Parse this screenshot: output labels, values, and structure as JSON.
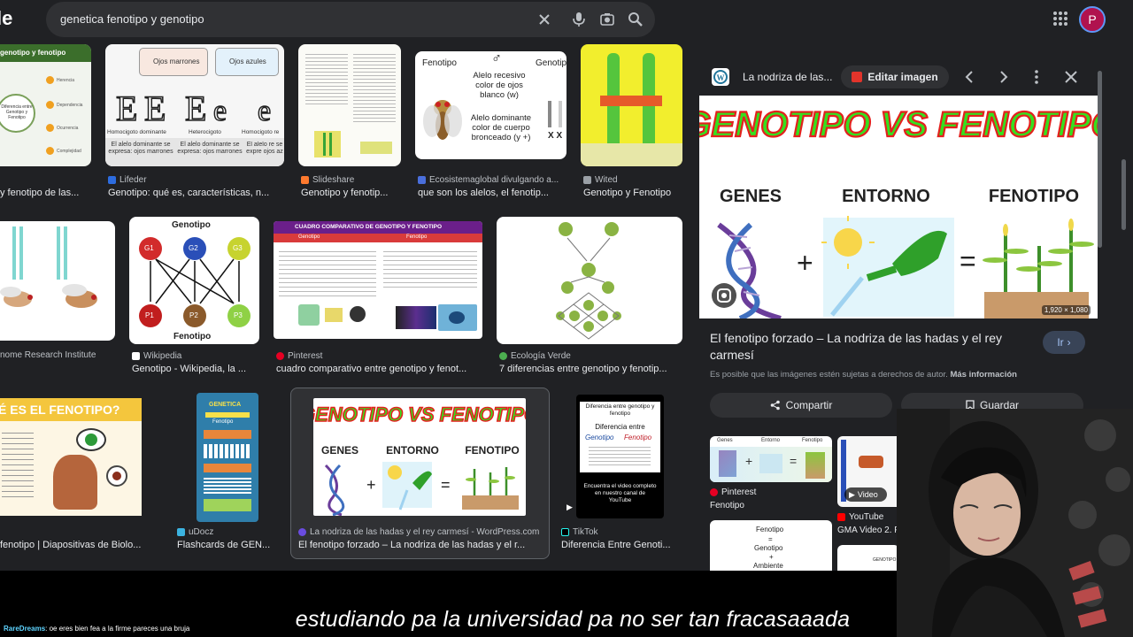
{
  "search": {
    "query": "genetica fenotipo y genotipo",
    "logo_fragment": "le"
  },
  "account": {
    "initial": "P"
  },
  "results": [
    {
      "source": "",
      "title": "y fenotipo de las...",
      "thumb_text": [
        "genotipo y fenotipo",
        "Diferencia entre Genotipo y Fenotipo",
        "Herencia",
        "Dependencia",
        "Ocurrencia",
        "Complejidad"
      ]
    },
    {
      "source": "Lifeder",
      "title": "Genotipo: qué es, características, n...",
      "thumb_text": [
        "Ojos marrones",
        "Ojos azules",
        "Homocigoto dominante",
        "Heterocigoto",
        "Homocigoto re",
        "El alelo dominante se expresa: ojos marrones",
        "El alelo dominante se expresa: ojos marrones",
        "El alelo re se expre ojos az"
      ]
    },
    {
      "source": "Slideshare",
      "title": "Genotipo y fenotip..."
    },
    {
      "source": "Ecosistemaglobal divulgando a...",
      "title": "que son los alelos, el fenotip...",
      "thumb_text": [
        "Fenotipo",
        "Genotip",
        "Alelo recesivo color de ojos blanco (w)",
        "Alelo dominante color de cuerpo bronceado (y +)",
        "X X"
      ]
    },
    {
      "source": "Wited",
      "title": "Genotipo y Fenotipo"
    },
    {
      "source": "",
      "title": "nome Research Institute"
    },
    {
      "source": "Wikipedia",
      "title": "Genotipo - Wikipedia, la ...",
      "thumb_text": [
        "Genotipo",
        "G1",
        "G2",
        "G3",
        "P1",
        "P2",
        "P3",
        "Fenotipo"
      ]
    },
    {
      "source": "Pinterest",
      "title": "cuadro comparativo entre genotipo y fenot...",
      "thumb_text": [
        "CUADRO COMPARATIVO DE GENOTIPO Y FENOTIPO",
        "Genotipo",
        "Fenotipo"
      ]
    },
    {
      "source": "Ecología Verde",
      "title": "7 diferencias entre genotipo y fenotip..."
    },
    {
      "source": "",
      "title": "fenotipo | Diapositivas de Biolo...",
      "thumb_text": [
        "É ES EL FENOTIPO?"
      ]
    },
    {
      "source": "uDocz",
      "title": "Flashcards de GEN...",
      "thumb_text": [
        "GENETICA",
        "Fenotipo"
      ]
    },
    {
      "source": "La nodriza de las hadas y el rey carmesí - WordPress.com",
      "title": "El fenotipo forzado – La nodriza de las hadas y el r...",
      "thumb_text": [
        "GENOTIPO VS FENOTIPO",
        "GENES",
        "ENTORNO",
        "FENOTIPO"
      ]
    },
    {
      "source": "TikTok",
      "title": "Diferencia Entre Genoti...",
      "thumb_text": [
        "Diferencia entre genotipo y fenotipo",
        "Diferencia entre",
        "Genotipo",
        "Fenotipo",
        "Encuentra el video completo en nuestro canal de YouTube"
      ]
    }
  ],
  "panel": {
    "site": "La nodriza de las...",
    "edit_label": "Editar imagen",
    "hero_title": "GENOTIPO VS FENOTIPO",
    "hero_labels": [
      "GENES",
      "ENTORNO",
      "FENOTIPO"
    ],
    "dimensions": "1,920 × 1,080",
    "title": "El fenotipo forzado – La nodriza de las hadas y el rey carmesí",
    "go_label": "Ir",
    "rights_text": "Es posible que las imágenes estén sujetas a derechos de autor.",
    "rights_link": "Más información",
    "share_label": "Compartir",
    "save_label": "Guardar",
    "related": [
      {
        "source": "Pinterest",
        "title": "Fenotipo",
        "thumb_text": [
          "Genes",
          "Entorno",
          "Fenotipo"
        ]
      },
      {
        "source": "YouTube",
        "title": "GMA Video 2. F",
        "badge": "Video"
      },
      {
        "source": "",
        "title": "",
        "thumb_text": [
          "Fenotipo",
          "=",
          "Genotipo",
          "+",
          "Ambiente"
        ]
      },
      {
        "source": "",
        "title": "",
        "thumb_text": [
          "GENOTIPO"
        ]
      }
    ]
  },
  "stream": {
    "chat_user": "RareDreams",
    "chat_message": ": oe eres bien fea a la firme pareces una bruja",
    "caption": "estudiando pa la universidad pa no ser tan fracasaaada"
  },
  "colors": {
    "page_bg": "#202124",
    "search_bg": "#303134",
    "accent_blue": "#a8c7fa",
    "go_button_bg": "#394457",
    "avatar_bg": "#b0124e",
    "hero_title_green": "#35e01e",
    "hero_title_red": "#e3211d"
  }
}
